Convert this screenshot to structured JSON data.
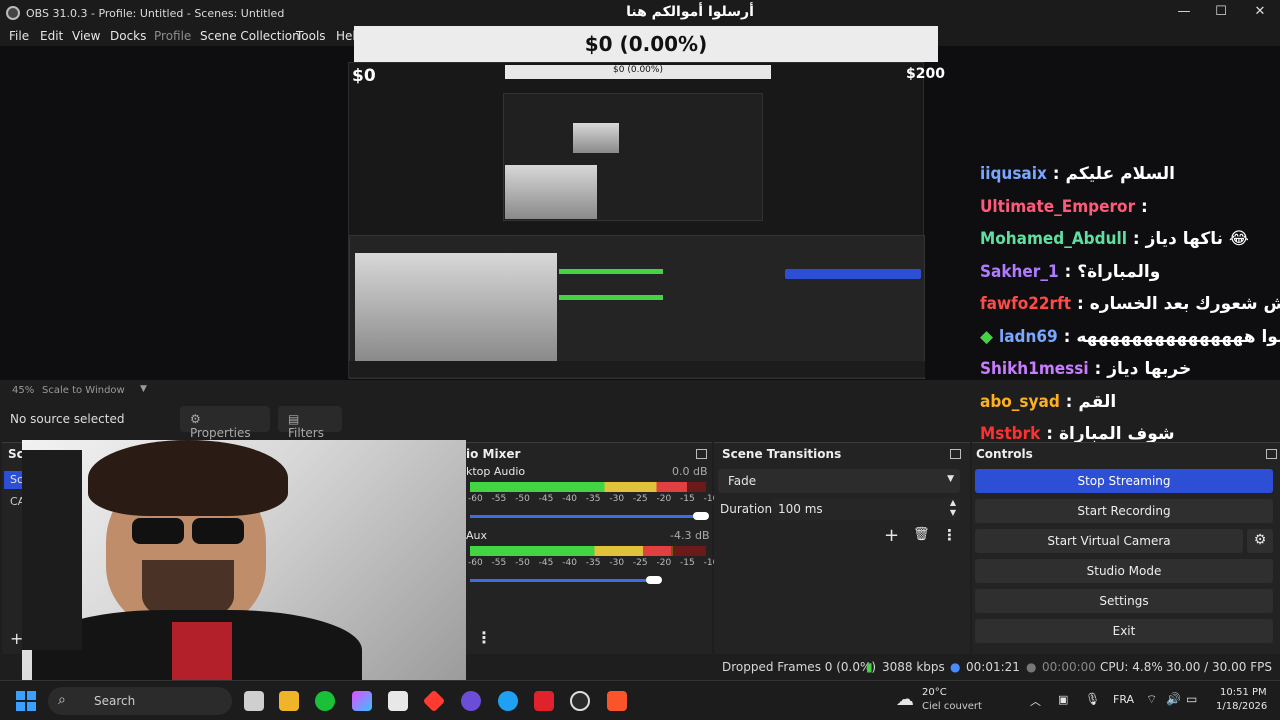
{
  "window": {
    "title": "OBS 31.0.3 - Profile: Untitled - Scenes: Untitled",
    "overlay_banner": "أرسلوا أموالكم هنا"
  },
  "menu": [
    "File",
    "Edit",
    "View",
    "Docks",
    "Profile",
    "Scene Collection",
    "Tools",
    "Hel"
  ],
  "donation": {
    "bar_text": "$0 (0.00%)",
    "min_label": "$0",
    "max_label": "$200",
    "progress_fraction": 0.0
  },
  "chat": [
    {
      "user": "iiqusaix",
      "message": "السلام عليكم",
      "color": "#7aa7ff",
      "badge": ""
    },
    {
      "user": "Ultimate_Emperor",
      "message": "",
      "color": "#ff5a7a",
      "badge": ""
    },
    {
      "user": "Mohamed_Abdull",
      "message": "ناكها دياز 😂",
      "color": "#5fe0a0",
      "badge": ""
    },
    {
      "user": "Sakher_1",
      "message": "والمباراة؟",
      "color": "#b07cff",
      "badge": ""
    },
    {
      "user": "fawfo22rft",
      "message": "وش شعورك بعد الخساره",
      "color": "#ff4a4a",
      "badge": ""
    },
    {
      "user": "ladn69",
      "message": "القموا هههههههههههههههه",
      "color": "#7aa7ff",
      "badge": "diamond-icon"
    },
    {
      "user": "Shikh1messi",
      "message": "خربها دياز",
      "color": "#c87cff",
      "badge": ""
    },
    {
      "user": "abo_syad",
      "message": "القم",
      "color": "#ffb020",
      "badge": ""
    },
    {
      "user": "Mstbrk",
      "message": "شوف المباراة",
      "color": "#ff3030",
      "badge": ""
    }
  ],
  "preview_bar": {
    "zoom": "45%",
    "scale_mode": "Scale to Window"
  },
  "source_bar": {
    "status": "No source selected",
    "properties": "Properties",
    "filters": "Filters"
  },
  "scenes": {
    "title": "Sc",
    "item_label": "Sc",
    "second_label": "CA"
  },
  "mixer": {
    "title": "io Mixer",
    "tracks": [
      {
        "name": "ktop Audio",
        "db": "0.0 dB",
        "level": 0.92,
        "volume": 0.98
      },
      {
        "name": "Aux",
        "db": "-4.3 dB",
        "level": 0.85,
        "volume": 0.78
      }
    ],
    "ticks": "-60 -55 -50 -45 -40 -35 -30 -25 -20 -15 -10 -5 0"
  },
  "transitions": {
    "title": "Scene Transitions",
    "selected": "Fade",
    "duration_label": "Duration",
    "duration_value": "100 ms"
  },
  "controls": {
    "title": "Controls",
    "buttons": [
      "Stop Streaming",
      "Start Recording",
      "Start Virtual Camera",
      "Studio Mode",
      "Settings",
      "Exit"
    ]
  },
  "status": {
    "dropped": "Dropped Frames 0 (0.0%)",
    "bitrate": "3088 kbps",
    "stream_time": "00:01:21",
    "rec_time": "00:00:00",
    "cpu": "CPU: 4.8%",
    "fps": "30.00 / 30.00 FPS"
  },
  "taskbar": {
    "search": "Search",
    "weather_temp": "20°C",
    "weather_desc": "Ciel couvert",
    "lang": "FRA",
    "time": "10:51 PM",
    "date": "1/18/2026"
  },
  "colors": {
    "accent": "#2d4fd6",
    "meter_green": "#43d443",
    "meter_yellow": "#e1c23b",
    "meter_red": "#e14040"
  }
}
